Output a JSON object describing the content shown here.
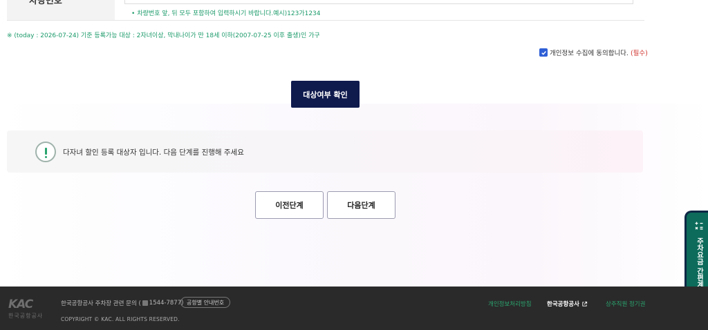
{
  "form": {
    "vehicle_label": "차량번호",
    "hint": "차량번호 앞, 뒤 모두 포함하여 입력하시기 바랍니다.예시)123가1234",
    "hint_bullet": "•"
  },
  "notice": "※ (today : 2026-07-24) 기준 등록가능 대상 : 2자녀이상, 막내나이가 만 18세 이하(2007-07-25 이후 출생)인 가구",
  "agree": {
    "checked": true,
    "label": "개인정보 수집에 동의합니다.",
    "required": "(필수)"
  },
  "check_button": "대상여부 확인",
  "result": {
    "icon": "exclamation-circle-icon",
    "message": "다자녀 할인 등록 대상자 입니다. 다음 단계를 진행해 주세요"
  },
  "buttons": {
    "prev": "이전단계",
    "next": "다음단계"
  },
  "side_tab": {
    "label": "주차요금 간편계산",
    "icon": "calculator-icon"
  },
  "footer": {
    "logo_text": "KAC",
    "logo_name": "한국공항공사",
    "contact_prefix": "한국공항공사 주차장 관련 문의 (",
    "phone": "1544-7877",
    "contact_suffix": ")",
    "airport_button": "공항별 안내번호",
    "copyright": "COPYRIGHT © KAC. ALL RIGHTS RESERVED.",
    "links": {
      "privacy": "개인정보처리방침",
      "kac": "한국공항공사",
      "ombudsman": "상주직원 정기권"
    }
  },
  "colors": {
    "primary_button": "#0f1a4d",
    "accent_green": "#1a9a6a",
    "required_red": "#d0332d",
    "checkbox_blue": "#2f5fd6",
    "footer_bg": "#2a2a2a",
    "side_tab": "#0c6b5a"
  }
}
